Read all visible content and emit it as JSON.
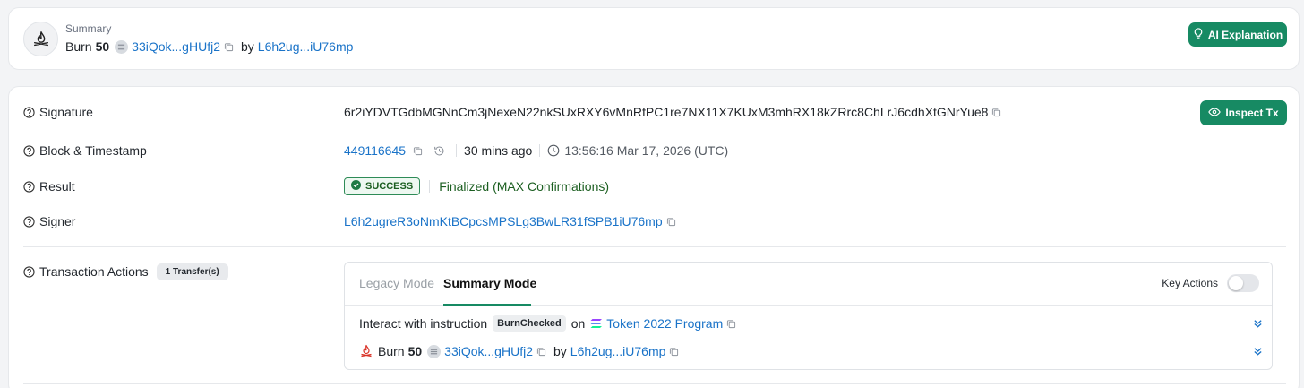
{
  "summary": {
    "label": "Summary",
    "action": "Burn",
    "amount": "50",
    "token_short": "33iQok...gHUfj2",
    "by": "by",
    "signer_short": "L6h2ug...iU76mp",
    "ai_button": "AI Explanation"
  },
  "details": {
    "signature": {
      "label": "Signature",
      "value": "6r2iYDVTGdbMGNnCm3jNexeN22nkSUxRXY6vMnRfPC1re7NX11X7KUxM3mhRX18kZRrc8ChLrJ6cdhXtGNrYue8"
    },
    "inspect_button": "Inspect Tx",
    "block": {
      "label": "Block & Timestamp",
      "number": "449116645",
      "relative": "30 mins ago",
      "timestamp": "13:56:16 Mar 17, 2026 (UTC)"
    },
    "result": {
      "label": "Result",
      "status": "SUCCESS",
      "finality": "Finalized (MAX Confirmations)"
    },
    "signer": {
      "label": "Signer",
      "value": "L6h2ugreR3oNmKtBCpcsMPSLg3BwLR31fSPB1iU76mp"
    },
    "actions": {
      "label": "Transaction Actions",
      "badge": "1 Transfer(s)",
      "tabs": [
        "Legacy Mode",
        "Summary Mode"
      ],
      "key_actions_label": "Key Actions",
      "instruction": {
        "prefix": "Interact with instruction",
        "name": "BurnChecked",
        "on": "on",
        "program": "Token 2022 Program"
      },
      "burn": {
        "action": "Burn",
        "amount": "50",
        "token_short": "33iQok...gHUfj2",
        "by": "by",
        "signer_short": "L6h2ug...iU76mp"
      }
    }
  },
  "colors": {
    "accent_green": "#178a63",
    "link_blue": "#1a73c8",
    "success_green": "#1b5e20"
  }
}
